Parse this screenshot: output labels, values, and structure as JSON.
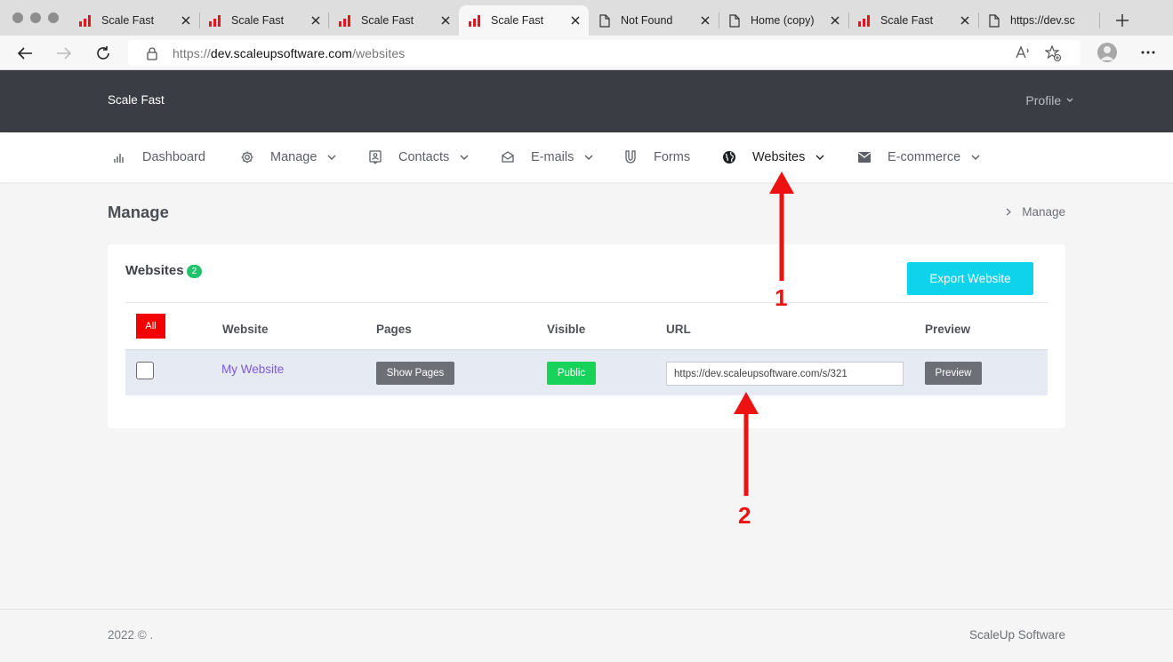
{
  "browser": {
    "tabs": [
      {
        "title": "Scale Fast",
        "icon": "bar-chart-icon"
      },
      {
        "title": "Scale Fast",
        "icon": "bar-chart-icon"
      },
      {
        "title": "Scale Fast",
        "icon": "bar-chart-icon"
      },
      {
        "title": "Scale Fast",
        "icon": "bar-chart-icon",
        "active": true
      },
      {
        "title": "Not Found",
        "icon": "page-icon"
      },
      {
        "title": "Home (copy)",
        "icon": "page-icon"
      },
      {
        "title": "Scale Fast",
        "icon": "bar-chart-icon"
      },
      {
        "title": "https://dev.sc",
        "icon": "page-icon"
      }
    ],
    "url_prefix": "https://",
    "url_host": "dev.scaleupsoftware.com",
    "url_path": "/websites",
    "accent": "#e8141b"
  },
  "header": {
    "brand": "Scale Fast",
    "profile": "Profile"
  },
  "nav": {
    "items": [
      {
        "label": "Dashboard",
        "icon": "bar-chart-icon"
      },
      {
        "label": "Manage",
        "icon": "gear-icon"
      },
      {
        "label": "Contacts",
        "icon": "contact-icon"
      },
      {
        "label": "E-mails",
        "icon": "envelope-open-icon"
      },
      {
        "label": "Forms",
        "icon": "magnet-icon"
      },
      {
        "label": "Websites",
        "icon": "globe-icon"
      },
      {
        "label": "E-commerce",
        "icon": "envelope-icon"
      }
    ]
  },
  "page": {
    "title": "Manage",
    "breadcrumb": "Manage"
  },
  "card": {
    "title": "Websites",
    "count": "2",
    "export_label": "Export Website",
    "all_label": "All",
    "columns": [
      "Website",
      "Pages",
      "Visible",
      "URL",
      "Preview"
    ],
    "rows": [
      {
        "website": "My Website",
        "pages_label": "Show Pages",
        "visible": "Public",
        "url": "https://dev.scaleupsoftware.com/s/321",
        "preview_label": "Preview"
      }
    ]
  },
  "footer": {
    "left": "2022 © .",
    "right": "ScaleUp Software"
  },
  "annotations": {
    "label_1": "1",
    "label_2": "2",
    "color": "#ee1111"
  }
}
